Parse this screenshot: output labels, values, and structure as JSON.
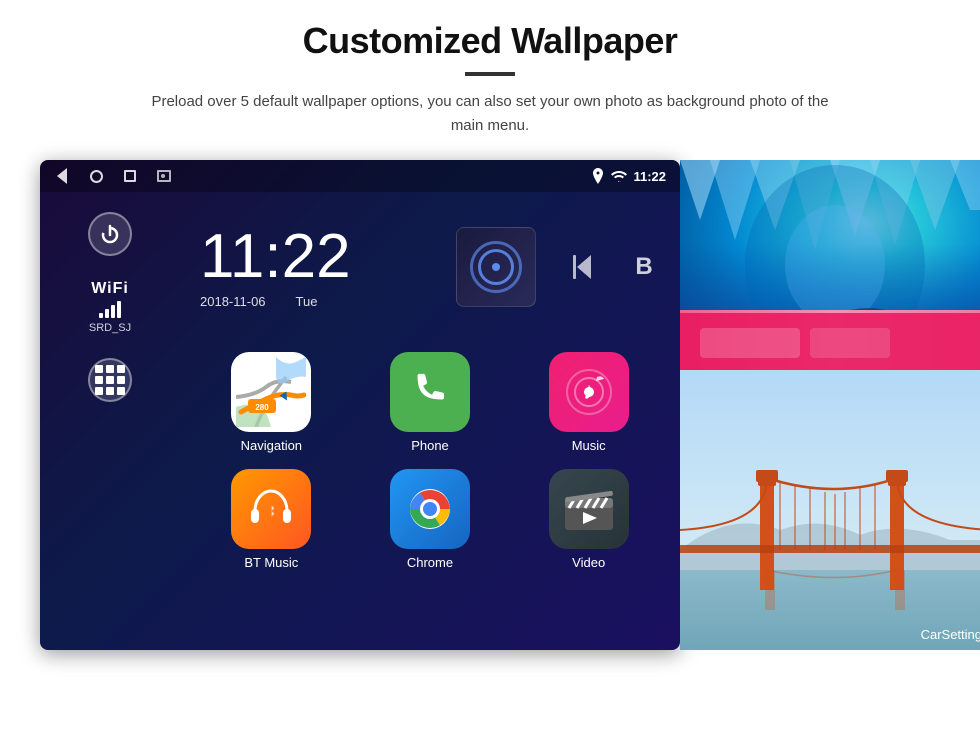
{
  "page": {
    "title": "Customized Wallpaper",
    "divider": true,
    "description": "Preload over 5 default wallpaper options, you can also set your own photo as background photo of the main menu."
  },
  "android": {
    "time": "11:22",
    "date": "2018-11-06",
    "day": "Tue",
    "wifi_label": "WiFi",
    "wifi_name": "SRD_SJ",
    "apps": [
      {
        "label": "Navigation",
        "icon": "map"
      },
      {
        "label": "Phone",
        "icon": "phone"
      },
      {
        "label": "Music",
        "icon": "music"
      },
      {
        "label": "BT Music",
        "icon": "bluetooth"
      },
      {
        "label": "Chrome",
        "icon": "chrome"
      },
      {
        "label": "Video",
        "icon": "video"
      }
    ],
    "carsetting_label": "CarSetting"
  }
}
